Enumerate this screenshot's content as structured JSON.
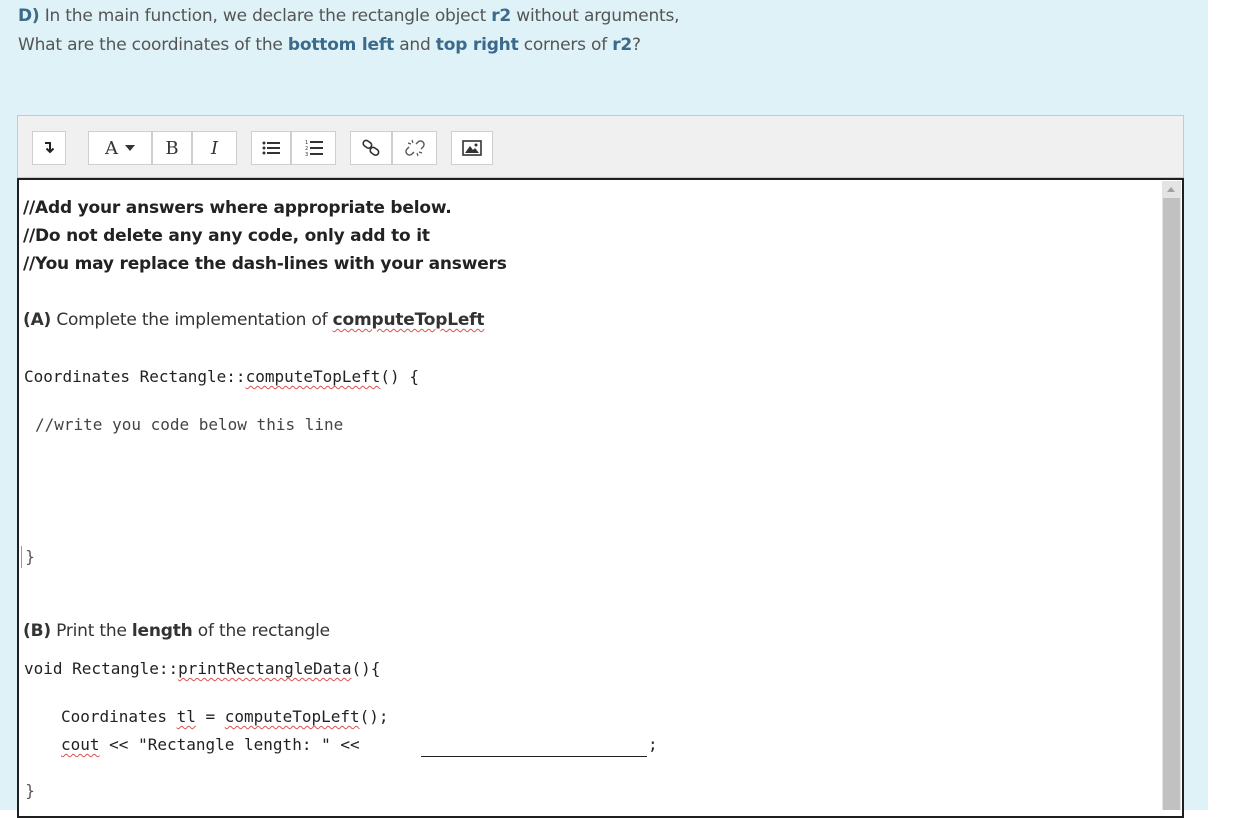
{
  "question": {
    "prefix": "D)",
    "line1_a": " In the main function, we declare the rectangle object ",
    "line1_obj": "r2",
    "line1_b": " without arguments,",
    "line2_a": "What are the coordinates of the ",
    "line2_bl": "bottom left",
    "line2_and": " and ",
    "line2_tr": "top right",
    "line2_b": " corners of ",
    "line2_obj": "r2",
    "line2_end": "?"
  },
  "toolbar": {
    "font_label": "A",
    "bold_label": "B",
    "italic_label": "I"
  },
  "editor": {
    "comment1": "//Add your answers where appropriate below.",
    "comment2": "//Do not delete any any code, only add to it",
    "comment3": "//You may replace the dash-lines with your answers",
    "partA_label": "(A)",
    "partA_text": " Complete the implementation of ",
    "partA_fn": "computeTopLeft",
    "codeA_sig_a": "Coordinates Rectangle::",
    "codeA_sig_fn": "computeTopLeft",
    "codeA_sig_b": "() {",
    "codeA_comment": "//write you code below this line",
    "closing_brace_1": "}",
    "partB_label": "(B)",
    "partB_text_a": " Print the ",
    "partB_bold": "length",
    "partB_text_b": " of the rectangle",
    "codeB_sig_a": "void Rectangle::",
    "codeB_sig_fn": "printRectangleData",
    "codeB_sig_b": "(){",
    "codeB_line1_a": "Coordinates ",
    "codeB_line1_tl": "tl",
    "codeB_line1_b": " = ",
    "codeB_line1_fn": "computeTopLeft",
    "codeB_line1_c": "();",
    "codeB_line2_cout": "cout",
    "codeB_line2_b": " << \"Rectangle length: \" <<",
    "codeB_line2_end": ";",
    "closing_brace_2": "}"
  }
}
